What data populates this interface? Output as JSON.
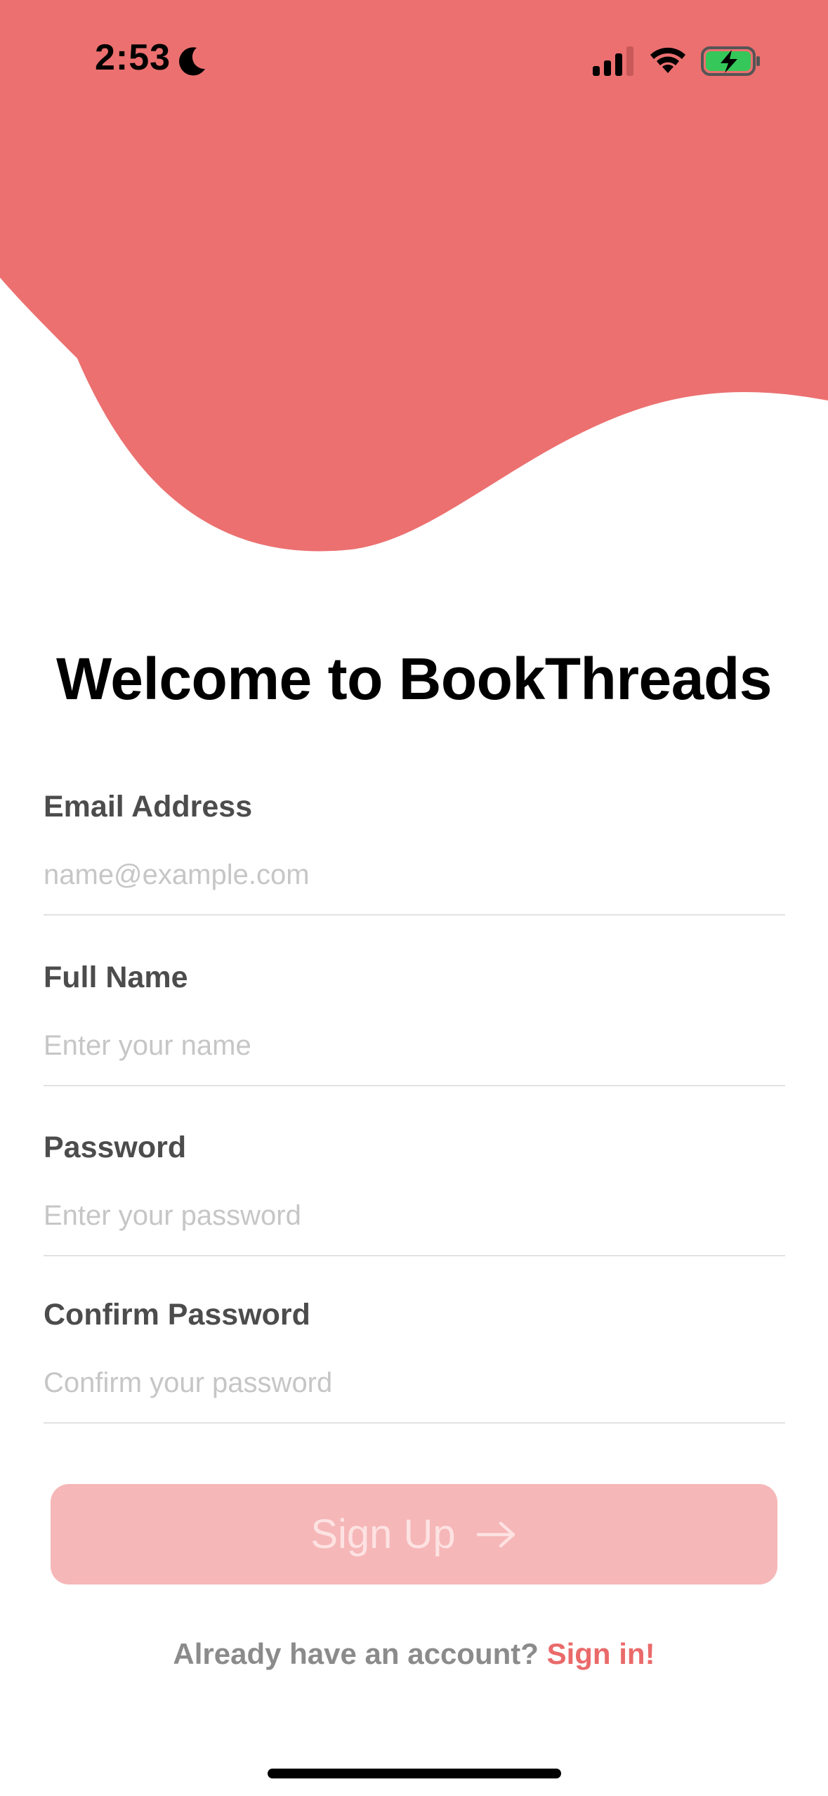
{
  "status_bar": {
    "time": "2:53",
    "icons": [
      "moon-icon",
      "cellular-signal-icon",
      "wifi-icon",
      "battery-charging-icon"
    ]
  },
  "header": {
    "title": "Welcome to BookThreads",
    "accent_color": "#ec7070"
  },
  "form": {
    "email": {
      "label": "Email Address",
      "placeholder": "name@example.com",
      "value": ""
    },
    "full_name": {
      "label": "Full Name",
      "placeholder": "Enter your name",
      "value": ""
    },
    "password": {
      "label": "Password",
      "placeholder": "Enter your password",
      "value": ""
    },
    "confirm_password": {
      "label": "Confirm Password",
      "placeholder": "Confirm your password",
      "value": ""
    }
  },
  "actions": {
    "signup_label": "Sign Up",
    "signup_icon": "arrow-right-icon",
    "signup_state": "disabled",
    "signin_prompt": "Already have an account?",
    "signin_link": "Sign in!"
  },
  "colors": {
    "accent": "#ec7070",
    "button_disabled": "#f6b7b8",
    "link": "#ea6a6a"
  }
}
